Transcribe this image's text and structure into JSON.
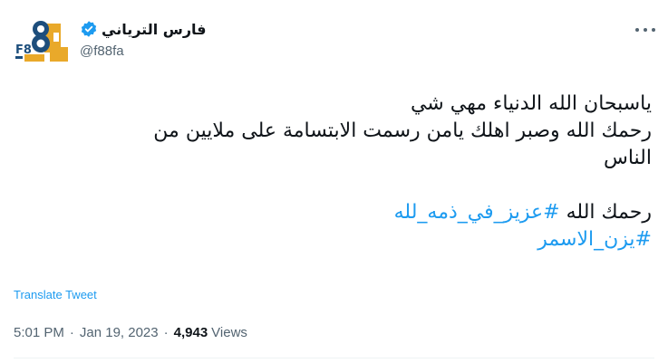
{
  "user": {
    "display_name": "فارس الترياني",
    "handle": "@f88fa",
    "verified": true,
    "avatar_lettering": "F8",
    "avatar_colors": {
      "blue": "#1d4e7c",
      "gold": "#e9a92a"
    }
  },
  "tweet": {
    "lines": [
      "ياسبحان الله الدنياء مهي شي",
      "رحمك الله وصبر اهلك يامن رسمت الابتسامة على ملايين من",
      "الناس"
    ],
    "closing_text": "رحمك الله",
    "hashtag_1": "#عزيز_في_ذمه_لله",
    "hashtag_2": "#يزن_الاسمر"
  },
  "translate_label": "Translate Tweet",
  "meta": {
    "time": "5:01 PM",
    "separator": "·",
    "date": "Jan 19, 2023",
    "views_count": "4,943",
    "views_label": "Views"
  },
  "colors": {
    "accent": "#1d9bf0",
    "text": "#0f1419",
    "secondary": "#536471"
  },
  "icons": {
    "verified": "verified-badge-icon",
    "more": "more-options-icon"
  }
}
